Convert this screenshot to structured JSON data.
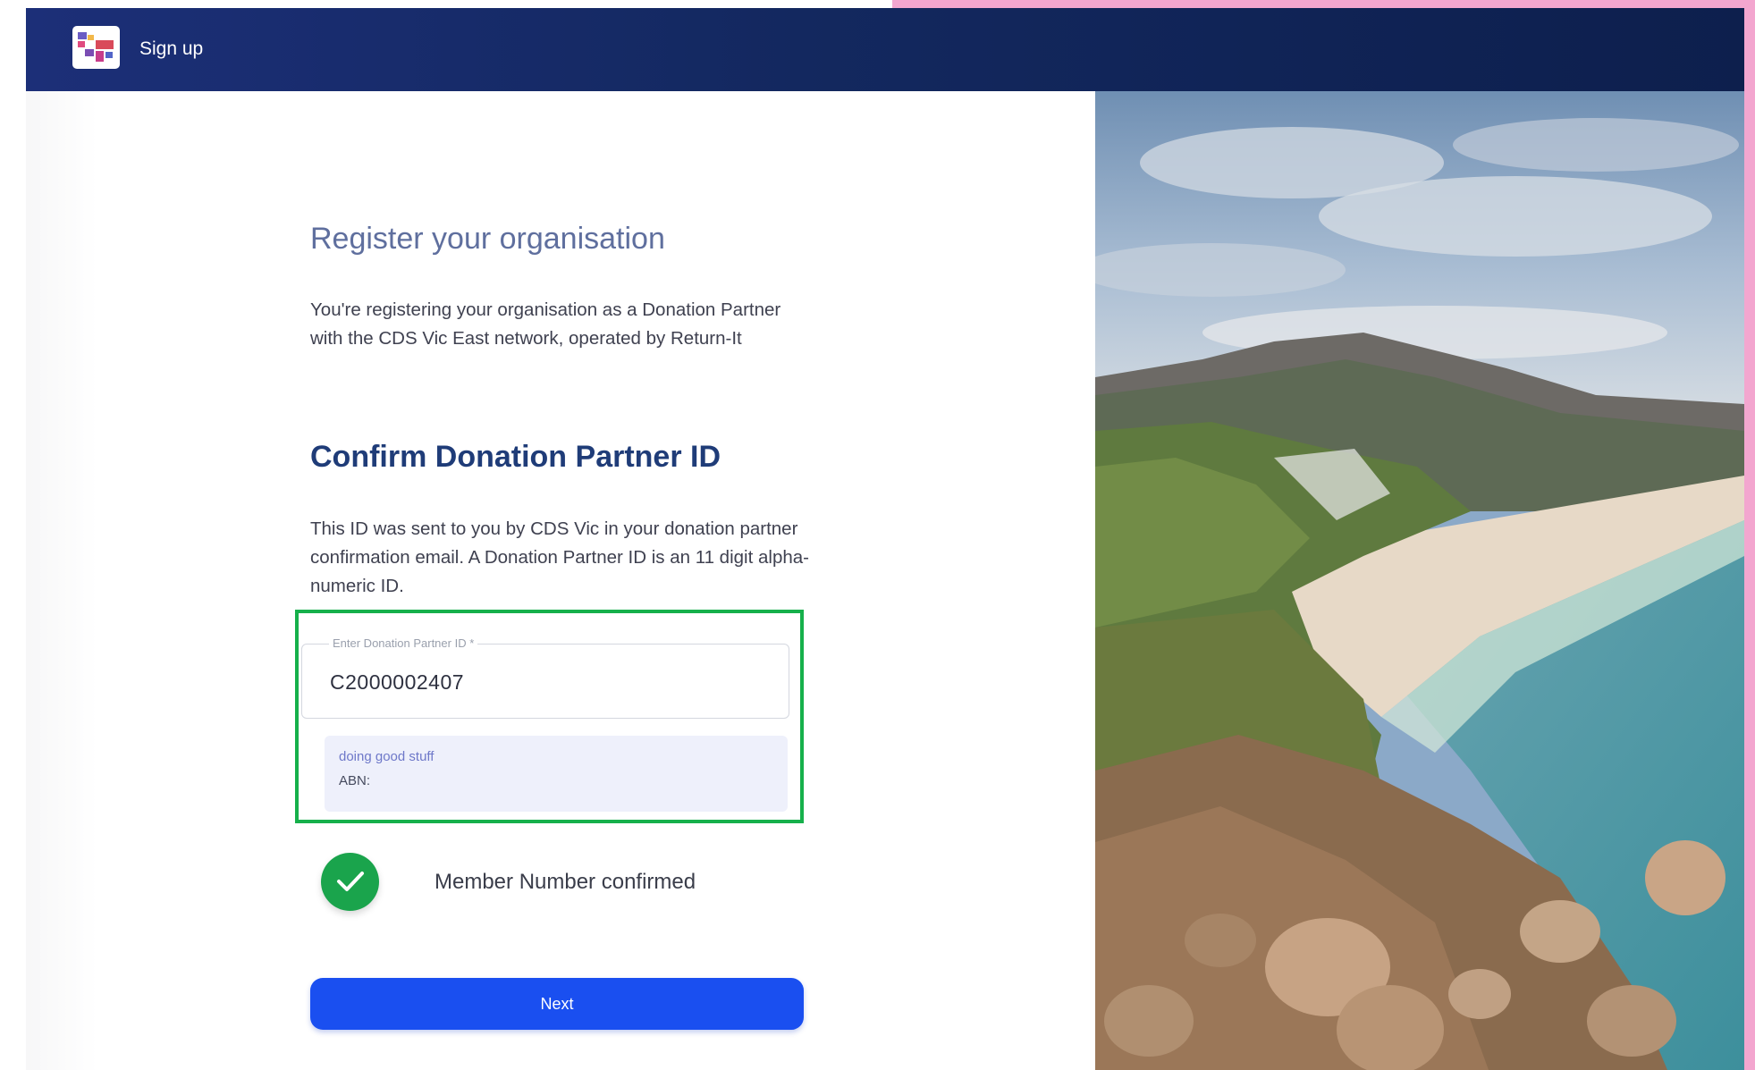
{
  "header": {
    "title": "Sign up",
    "logo_icon": "cds-vic-logo-icon",
    "background": "#13285f"
  },
  "register": {
    "heading": "Register your organisation",
    "description": "You're registering your organisation as a Donation Partner with the CDS Vic East network, operated by Return-It"
  },
  "confirm": {
    "heading": "Confirm Donation Partner ID",
    "description": "This ID was sent to you by CDS Vic in your donation partner confirmation email. A Donation Partner ID is an 11 digit alpha-numeric ID.",
    "input_label": "Enter Donation Partner ID *",
    "input_value": "C2000002407",
    "org_name": "doing good stuff",
    "abn_label": "ABN:",
    "highlight_color": "#16b04b"
  },
  "status": {
    "icon": "check-circle-icon",
    "text": "Member Number confirmed",
    "color": "#1aa44c"
  },
  "actions": {
    "next_label": "Next",
    "next_color": "#1a4ff0"
  },
  "image": {
    "subject": "coastal-landscape-photo"
  }
}
